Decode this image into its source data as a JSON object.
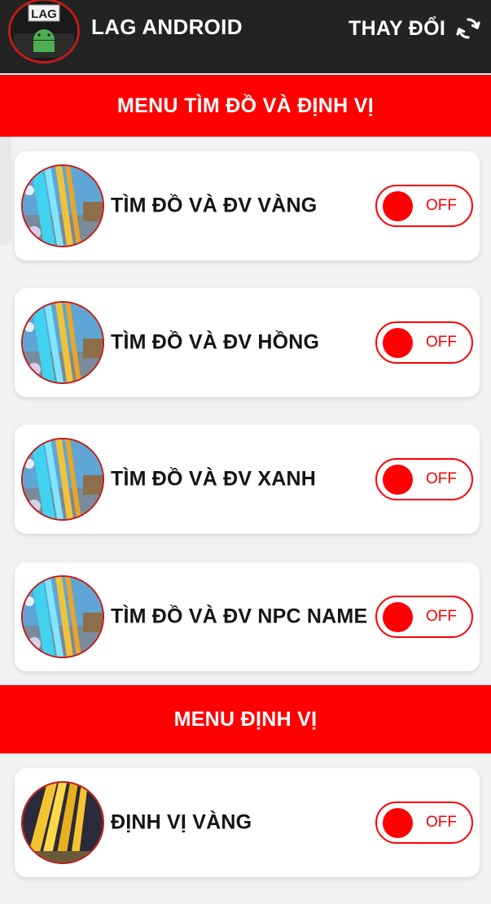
{
  "app": {
    "title": "LAG ANDROID",
    "logo_text": "LAG",
    "change_label": "THAY ĐỔI",
    "change_icon": "refresh-icon"
  },
  "sections": [
    {
      "title": "MENU TÌM ĐỒ VÀ ĐỊNH VỊ",
      "items": [
        {
          "label": "TÌM ĐỒ VÀ ĐV VÀNG",
          "toggle": "OFF"
        },
        {
          "label": "TÌM ĐỒ VÀ ĐV HỒNG",
          "toggle": "OFF"
        },
        {
          "label": "TÌM ĐỒ VÀ ĐV XANH",
          "toggle": "OFF"
        },
        {
          "label": "TÌM ĐỒ VÀ ĐV NPC NAME",
          "toggle": "OFF"
        }
      ]
    },
    {
      "title": "MENU ĐỊNH VỊ",
      "items": [
        {
          "label": "ĐỊNH VỊ VÀNG",
          "toggle": "OFF"
        }
      ]
    }
  ],
  "colors": {
    "accent": "#fe0000",
    "topbar": "#232323",
    "background": "#f2f2f2"
  }
}
